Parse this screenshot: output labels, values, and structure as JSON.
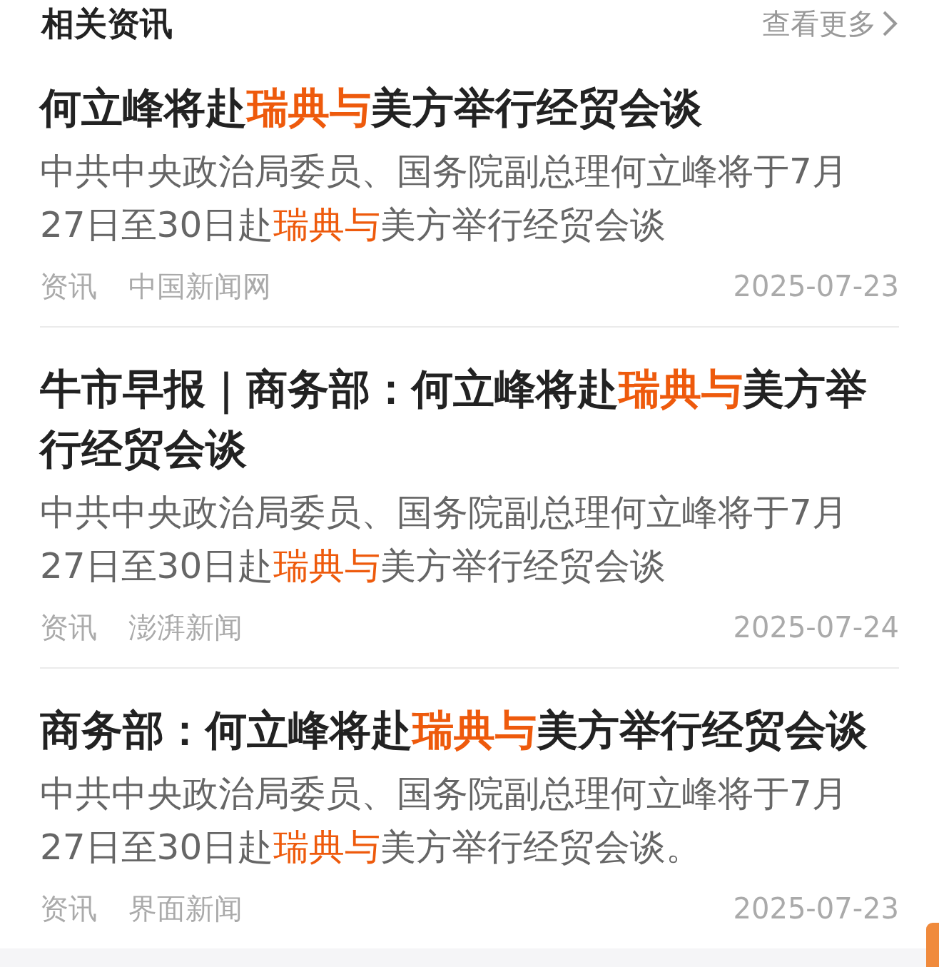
{
  "header": {
    "title": "相关资讯",
    "more": "查看更多"
  },
  "articles": [
    {
      "title": [
        {
          "text": "何立峰将赴",
          "highlight": false
        },
        {
          "text": "瑞典与",
          "highlight": true
        },
        {
          "text": "美方举行经贸会谈",
          "highlight": false
        }
      ],
      "summary": [
        {
          "text": "中共中央政治局委员、国务院副总理何立峰将于7月27日至30日赴",
          "highlight": false
        },
        {
          "text": "瑞典与",
          "highlight": true
        },
        {
          "text": "美方举行经贸会谈",
          "highlight": false
        }
      ],
      "category": "资讯",
      "source": "中国新闻网",
      "date": "2025-07-23"
    },
    {
      "title": [
        {
          "text": "牛市早报｜商务部：何立峰将赴",
          "highlight": false
        },
        {
          "text": "瑞典与",
          "highlight": true
        },
        {
          "text": "美方举行经贸会谈",
          "highlight": false
        }
      ],
      "summary": [
        {
          "text": "中共中央政治局委员、国务院副总理何立峰将于7月27日至30日赴",
          "highlight": false
        },
        {
          "text": "瑞典与",
          "highlight": true
        },
        {
          "text": "美方举行经贸会谈",
          "highlight": false
        }
      ],
      "category": "资讯",
      "source": "澎湃新闻",
      "date": "2025-07-24"
    },
    {
      "title": [
        {
          "text": "商务部：何立峰将赴",
          "highlight": false
        },
        {
          "text": "瑞典与",
          "highlight": true
        },
        {
          "text": "美方举行经贸会谈",
          "highlight": false
        }
      ],
      "summary": [
        {
          "text": "中共中央政治局委员、国务院副总理何立峰将于7月27日至30日赴",
          "highlight": false
        },
        {
          "text": "瑞典与",
          "highlight": true
        },
        {
          "text": "美方举行经贸会谈。",
          "highlight": false
        }
      ],
      "category": "资讯",
      "source": "界面新闻",
      "date": "2025-07-23"
    }
  ]
}
